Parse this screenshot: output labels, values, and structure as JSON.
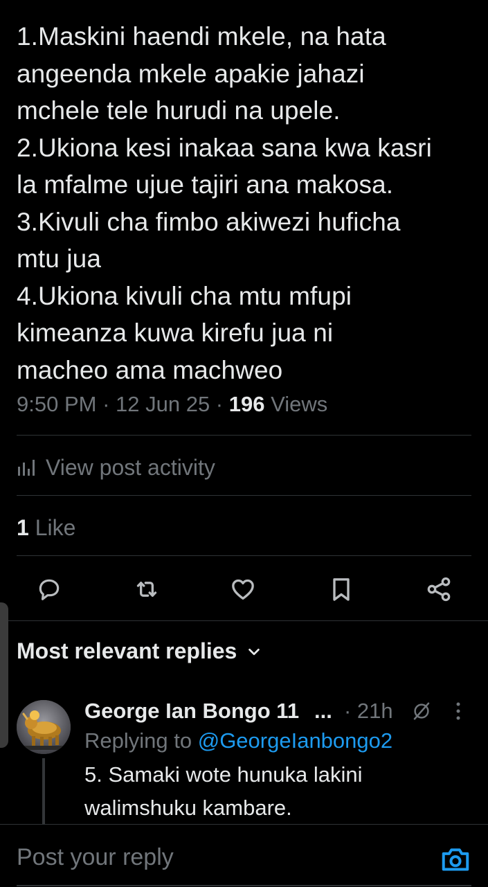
{
  "tweet": {
    "text": "1.Maskini haendi mkele, na hata\nangeenda mkele apakie jahazi\nmchele tele hurudi na upele.\n2.Ukiona kesi inakaa sana kwa kasri\nla mfalme ujue tajiri ana makosa.\n3.Kivuli cha fimbo akiwezi huficha\nmtu jua\n4.Ukiona kivuli cha mtu mfupi\nkimeanza kuwa kirefu jua ni\nmacheo ama machweo",
    "time": "9:50 PM",
    "separator1": " · ",
    "date": "12 Jun 25",
    "separator2": " · ",
    "views_count": "196",
    "views_label": " Views"
  },
  "activity": {
    "label": "View post activity",
    "icon": "analytics-icon"
  },
  "likes": {
    "count": "1",
    "label": " Like"
  },
  "actions": [
    {
      "name": "reply",
      "icon": "reply-icon"
    },
    {
      "name": "repost",
      "icon": "repost-icon"
    },
    {
      "name": "like",
      "icon": "heart-icon"
    },
    {
      "name": "bookmark",
      "icon": "bookmark-icon"
    },
    {
      "name": "share",
      "icon": "share-icon"
    }
  ],
  "replies": {
    "header": "Most relevant replies",
    "items": [
      {
        "display_name": "George Ian Bongo 11",
        "ellipsis": "...",
        "time": "· 21h",
        "replying_label": "Replying to ",
        "replying_handle": "@GeorgeIanbongo2",
        "text": "5. Samaki wote hunuka lakini\nwalimshuku kambare."
      }
    ]
  },
  "compose": {
    "placeholder": "Post your reply"
  },
  "colors": {
    "background": "#000000",
    "text_primary": "#e7e9ea",
    "text_secondary": "#71767b",
    "accent": "#1d9bf0",
    "divider": "#2f3336"
  }
}
